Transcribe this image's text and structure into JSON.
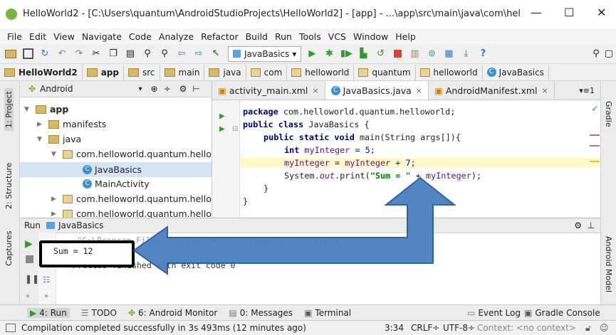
{
  "window": {
    "title": "HelloWorld2 - [C:\\Users\\quantum\\AndroidStudioProjects\\HelloWorld2] - [app] - ...\\app\\src\\main\\java\\com\\helloworld\\qu...",
    "minimize": "—",
    "maximize": "☐",
    "close": "✕"
  },
  "menu": [
    "File",
    "Edit",
    "View",
    "Navigate",
    "Code",
    "Analyze",
    "Refactor",
    "Build",
    "Run",
    "Tools",
    "VCS",
    "Window",
    "Help"
  ],
  "toolbar": {
    "run_config": "JavaBasics",
    "dropdown_arrow": "▾",
    "help": "?"
  },
  "breadcrumb": [
    "HelloWorld2",
    "app",
    "src",
    "main",
    "java",
    "com",
    "helloworld",
    "quantum",
    "helloworld",
    "JavaBasics"
  ],
  "left_stripe": {
    "project": "1: Project",
    "structure": "2: Structure",
    "captures": "Captures"
  },
  "right_stripe": {
    "gradle": "Gradle",
    "android_model": "Android Model"
  },
  "project_panel": {
    "view": "Android",
    "tree": [
      {
        "label": "app",
        "bold": true
      },
      {
        "label": "manifests"
      },
      {
        "label": "java"
      },
      {
        "label": "com.helloworld.quantum.hellowo"
      },
      {
        "label": "JavaBasics"
      },
      {
        "label": "MainActivity"
      },
      {
        "label": "com.helloworld.quantum.hellowo"
      },
      {
        "label": "com.helloworld.quantum.hellowo"
      }
    ]
  },
  "editor": {
    "tabs": [
      {
        "label": "activity_main.xml",
        "close": "×"
      },
      {
        "label": "JavaBasics.java",
        "close": "×",
        "active": true
      },
      {
        "label": "AndroidManifest.xml",
        "close": "×"
      }
    ],
    "tab_overflow": "▾≡1",
    "code": {
      "l1_kw": "package",
      "l1_rest": " com.helloworld.quantum.helloworld;",
      "l2_kw": "public class",
      "l2_rest": " JavaBasics {",
      "l3_kw": "public static void",
      "l3_rest": " main(String args[]){",
      "l4_kw": "int",
      "l4_var": "myInteger",
      "l4_mid": " = ",
      "l4_num": "5",
      "l4_end": ";",
      "l5_var": "myInteger",
      "l5_mid": " = ",
      "l5_var2": "myInteger",
      "l5_op": " + ",
      "l5_num": "7",
      "l5_end": ";",
      "l6_a": "System.",
      "l6_out": "out",
      "l6_b": ".print(",
      "l6_str": "\"Sum = \"",
      "l6_c": " + ",
      "l6_var": "myInteger",
      "l6_d": ");",
      "l7": "}",
      "l8": "}"
    }
  },
  "run_panel": {
    "tab_label": "Run",
    "config": "JavaBasics",
    "output_line1": "\"C:\\Program Files\\Android\\Android Studio\\jre\\bin\\java\"",
    "output_line2": "Sum = 12",
    "output_line3": "Process finished with exit code 0"
  },
  "bottom_tools": {
    "run": "4: Run",
    "todo": "TODO",
    "monitor": "6: Android Monitor",
    "messages": "0: Messages",
    "terminal": "Terminal",
    "event_log": "Event Log",
    "gradle_console": "Gradle Console"
  },
  "status": {
    "message": "Compilation completed successfully in 3s 493ms (12 minutes ago)",
    "position": "3:34",
    "line_sep": "CRLF÷",
    "encoding": "UTF-8÷",
    "context": "Context: <no context>"
  },
  "colors": {
    "arrow_fill": "#4a7fc1",
    "arrow_stroke": "#2b5a94"
  }
}
